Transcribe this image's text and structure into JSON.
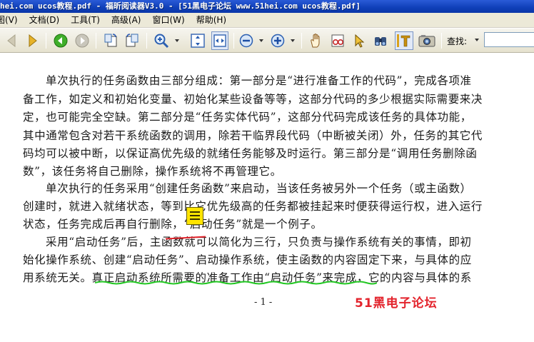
{
  "window": {
    "title": "hei.com ucos教程.pdf - 福昕阅读器V3.0 - [51黑电子论坛 www.51hei.com ucos教程.pdf]"
  },
  "menu": {
    "items": [
      {
        "label": "图(V)"
      },
      {
        "label": "文档(D)"
      },
      {
        "label": "工具(T)"
      },
      {
        "label": "高级(A)"
      },
      {
        "label": "窗口(W)"
      },
      {
        "label": "帮助(H)"
      }
    ]
  },
  "toolbar": {
    "icons": [
      "back-arrow-icon",
      "forward-arrow-icon",
      "go-back-icon",
      "go-forward-icon",
      "rotate-left-icon",
      "rotate-right-icon",
      "zoom-in-icon",
      "fit-page-icon",
      "fit-width-icon",
      "zoom-out-icon",
      "zoom-in-plus-icon",
      "hand-tool-icon",
      "reading-glasses-icon",
      "select-arrow-icon",
      "binoculars-icon",
      "text-select-icon",
      "snapshot-icon"
    ],
    "search_label": "查找:",
    "search_value": ""
  },
  "document": {
    "lines": [
      "单次执行的任务函数由三部分组成：第一部分是“进行准备工作的代码”，完成各项准",
      "备工作，如定义和初始化变量、初始化某些设备等等，这部分代码的多少根据实际需要来决",
      "定，也可能完全空缺。第二部分是“任务实体代码”，这部分代码完成该任务的具体功能，",
      "其中通常包含对若干系统函数的调用，除若干临界段代码（中断被关闭）外，任务的其它代",
      "码均可以被中断，以保证高优先级的就绪任务能够及时运行。第三部分是“调用任务删除函",
      "数”，该任务将自己删除，操作系统将不再管理它。",
      "单次执行的任务采用“创建任务函数”来启动，当该任务被另外一个任务（或主函数）",
      "创建时，就进入就绪状态，等到比它优先级高的任务都被挂起来时便获得运行权，进入运行",
      "状态，任务完成后再自行删除，“启动任务”就是一个例子。",
      "采用“启动任务”后，主函数就可以简化为三行，只负责与操作系统有关的事情，即初",
      "始化操作系统、创建“启动任务”、启动操作系统，使主函数的内容固定下来，与具体的应",
      "用系统无关。真正启动系统所需要的准备工作由“启动任务”来完成，它的内容与具体的系"
    ],
    "page_number": "- 1 -",
    "watermark": "51黑电子论坛"
  },
  "colors": {
    "title_bar": "#0f3fb8",
    "menu_bg": "#ece9d8",
    "watermark": "#e3232c",
    "note": "#ffe500",
    "strike": "#e3262d",
    "underline": "#22c722"
  }
}
